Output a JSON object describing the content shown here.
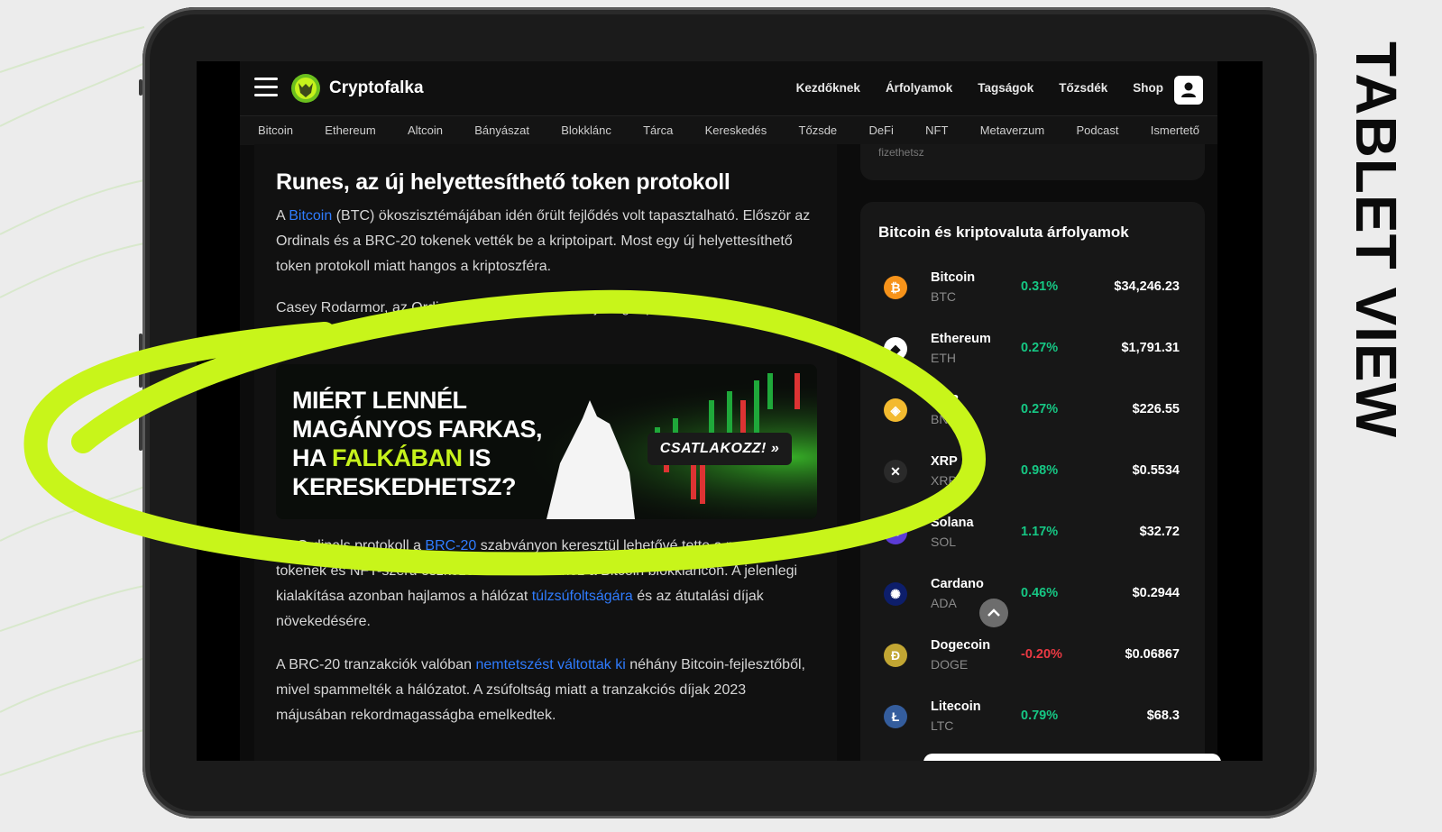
{
  "side_label": "TABLET VIEW",
  "header": {
    "logo_text": "Cryptofalka",
    "nav": [
      "Kezdőknek",
      "Árfolyamok",
      "Tagságok",
      "Tőzsdék",
      "Shop"
    ]
  },
  "categories": [
    "Bitcoin",
    "Ethereum",
    "Altcoin",
    "Bányászat",
    "Blokklánc",
    "Tárca",
    "Kereskedés",
    "Tőzsde",
    "DeFi",
    "NFT",
    "Metaverzum",
    "Podcast",
    "Ismertető"
  ],
  "article": {
    "title": "Runes, az új helyettesíthető token protokoll",
    "p1": {
      "pre": "A ",
      "link": "Bitcoin",
      "post": " (BTC) ökoszisztémájában idén őrült fejlődés volt tapasztalható. Először az Ordinals és a BRC-20 tokenek vették be a kriptoipart. Most egy új helyettesíthető token protokoll miatt hangos a kriptoszféra."
    },
    "p2": "Casey Rodarmor, az Ordinals protokoll megalkotója tegnap egy új,",
    "p3": {
      "pre": "Az Ordinals protokoll a ",
      "link1": "BRC-20",
      "mid": " szabványon keresztül lehetővé tette a meme tokenek és NFT-szerű eszközök kibocsátásához a Bitcoin blokkláncon. A jelenlegi kialakítása azonban hajlamos a hálózat ",
      "link2": "túlzsúfoltságára",
      "post": " és az átutalási díjak növekedésére."
    },
    "p4": {
      "pre": "A BRC-20 tranzakciók valóban ",
      "link": "nemtetszést váltottak ki",
      "post": " néhány Bitcoin-fejlesztőből, mivel spammelték a hálózatot. A zsúfoltság miatt a tranzakciós díjak 2023 májusában rekordmagasságba emelkedtek."
    }
  },
  "banner": {
    "line1": "MIÉRT LENNÉL",
    "line2": "MAGÁNYOS FARKAS,",
    "line3_pre": "HA ",
    "line3_hl": "FALKÁBAN",
    "line3_post": " IS",
    "line4": "KERESKEDHETSZ?",
    "cta": "CSATLAKOZZ!"
  },
  "sidebar": {
    "top_fragment": "fizethetsz",
    "rates_title": "Bitcoin és kriptovaluta árfolyamok",
    "coins": [
      {
        "name": "Bitcoin",
        "symbol": "BTC",
        "change": "0.31%",
        "price": "$34,246.23",
        "color": "#f7931a",
        "glyph": "₿",
        "up": true
      },
      {
        "name": "Ethereum",
        "symbol": "ETH",
        "change": "0.27%",
        "price": "$1,791.31",
        "color": "#ffffff",
        "glyph": "◆",
        "up": true
      },
      {
        "name": "BNB",
        "symbol": "BNB",
        "change": "0.27%",
        "price": "$226.55",
        "color": "#f3ba2f",
        "glyph": "◈",
        "up": true
      },
      {
        "name": "XRP",
        "symbol": "XRP",
        "change": "0.98%",
        "price": "$0.5534",
        "color": "#2a2a2a",
        "glyph": "✕",
        "up": true
      },
      {
        "name": "Solana",
        "symbol": "SOL",
        "change": "1.17%",
        "price": "$32.72",
        "color": "#5c3bd6",
        "glyph": "≡",
        "up": true
      },
      {
        "name": "Cardano",
        "symbol": "ADA",
        "change": "0.46%",
        "price": "$0.2944",
        "color": "#0d1e6b",
        "glyph": "✺",
        "up": true
      },
      {
        "name": "Dogecoin",
        "symbol": "DOGE",
        "change": "-0.20%",
        "price": "$0.06867",
        "color": "#c2a633",
        "glyph": "Ð",
        "up": false
      },
      {
        "name": "Litecoin",
        "symbol": "LTC",
        "change": "0.79%",
        "price": "$68.3",
        "color": "#345d9d",
        "glyph": "Ł",
        "up": true
      }
    ]
  },
  "colors": {
    "up": "#16c784",
    "down": "#ea3943",
    "accent": "#c6f21c",
    "link": "#2f7cff"
  }
}
